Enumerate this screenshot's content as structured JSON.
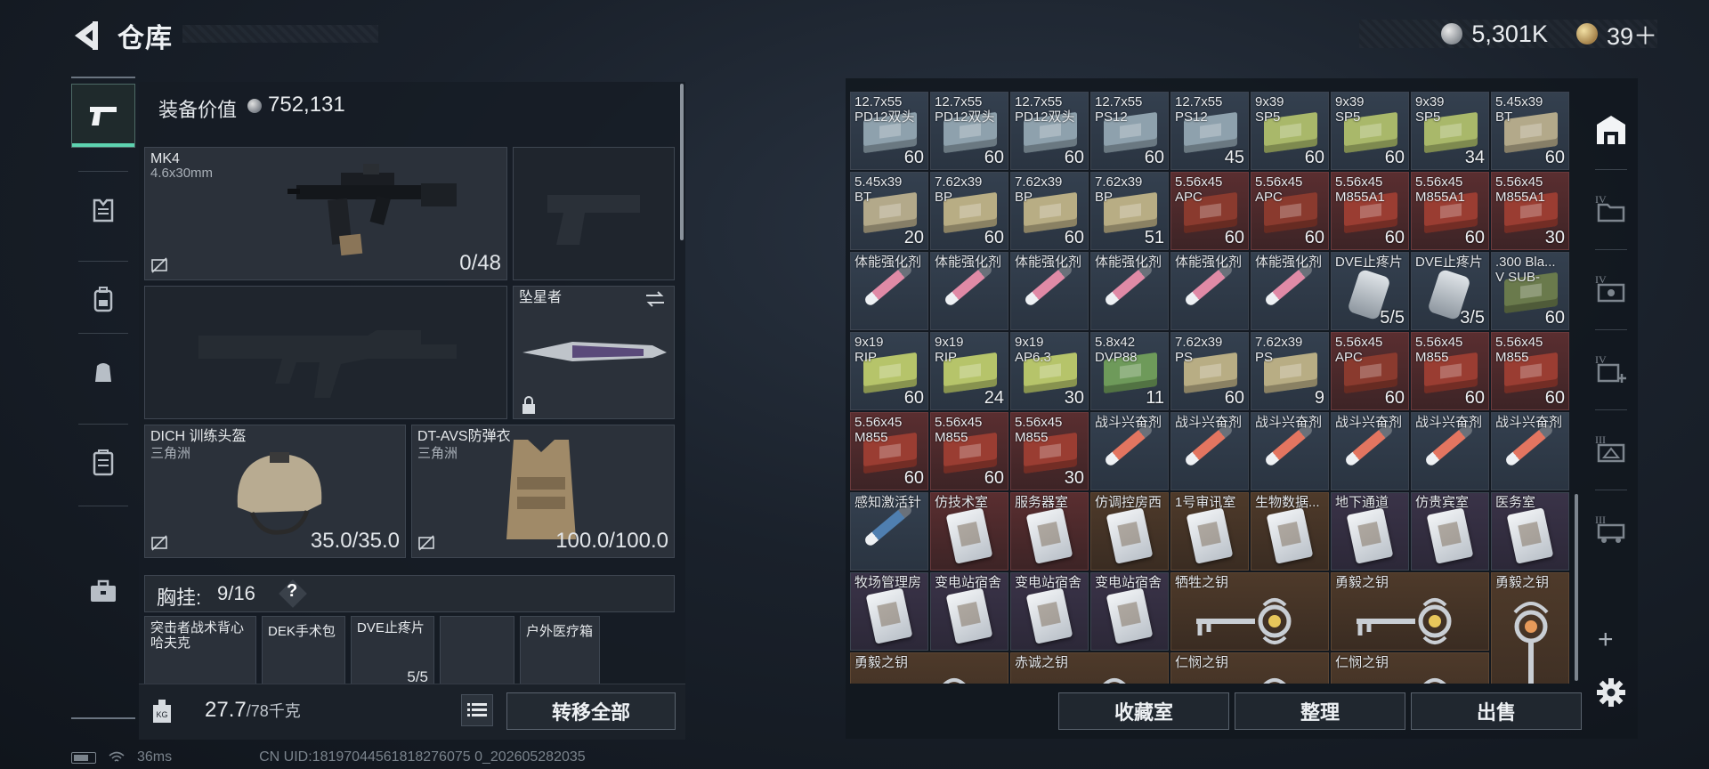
{
  "header": {
    "title": "仓库",
    "currency_silver": "5,301K",
    "currency_gold": "39＋"
  },
  "equipment": {
    "value_label": "装备价值",
    "value": "752,131",
    "primary": {
      "name": "MK4",
      "caliber": "4.6x30mm",
      "ammo": "0/48"
    },
    "melee": {
      "name": "坠星者"
    },
    "helmet": {
      "name": "DICH 训练头盔",
      "origin": "三角洲",
      "durability": "35.0/35.0"
    },
    "armor": {
      "name": "DT-AVS防弹衣",
      "origin": "三角洲",
      "durability": "100.0/100.0"
    },
    "chest_rig": {
      "label": "胸挂:",
      "value": "9/16",
      "help": "?"
    },
    "rig_items": [
      {
        "name": "突击者战术背心\n哈夫克"
      },
      {
        "name": "DEK手术包"
      },
      {
        "name": "DVE止疼片",
        "count": "5/5"
      },
      {
        "name": ""
      },
      {
        "name": "户外医疗箱"
      }
    ]
  },
  "footer_left": {
    "weight": "27.7",
    "weight_max": "/78千克",
    "transfer_all": "转移全部"
  },
  "inventory": [
    [
      {
        "name": "12.7x55\nPD12双头",
        "count": "60",
        "kind": "ammo",
        "color": "#8ea1ad"
      },
      {
        "name": "12.7x55\nPD12双头",
        "count": "60",
        "kind": "ammo",
        "color": "#8ea1ad"
      },
      {
        "name": "12.7x55\nPD12双头",
        "count": "60",
        "kind": "ammo",
        "color": "#8ea1ad"
      },
      {
        "name": "12.7x55\nPS12",
        "count": "60",
        "kind": "ammo",
        "color": "#8ea1ad"
      },
      {
        "name": "12.7x55\nPS12",
        "count": "45",
        "kind": "ammo",
        "color": "#8ea1ad"
      },
      {
        "name": "9x39\nSP5",
        "count": "60",
        "kind": "ammo",
        "color": "#a9b86a"
      },
      {
        "name": "9x39\nSP5",
        "count": "60",
        "kind": "ammo",
        "color": "#a9b86a"
      },
      {
        "name": "9x39\nSP5",
        "count": "34",
        "kind": "ammo",
        "color": "#a9b86a"
      },
      {
        "name": "5.45x39\nBT",
        "count": "60",
        "kind": "ammo",
        "color": "#b3a98a"
      }
    ],
    [
      {
        "name": "5.45x39\nBT",
        "count": "20",
        "kind": "ammo",
        "color": "#b3a98a"
      },
      {
        "name": "7.62x39\nBP",
        "count": "60",
        "kind": "ammo",
        "color": "#b8ad84"
      },
      {
        "name": "7.62x39\nBP",
        "count": "60",
        "kind": "ammo",
        "color": "#b8ad84"
      },
      {
        "name": "7.62x39\nBP",
        "count": "51",
        "kind": "ammo",
        "color": "#b8ad84"
      },
      {
        "name": "5.56x45\nAPC",
        "count": "60",
        "kind": "ammo",
        "color": "#8a3a2e",
        "tone": "red"
      },
      {
        "name": "5.56x45\nAPC",
        "count": "60",
        "kind": "ammo",
        "color": "#8a3a2e",
        "tone": "red"
      },
      {
        "name": "5.56x45\nM855A1",
        "count": "60",
        "kind": "ammo",
        "color": "#9a3d32",
        "tone": "red"
      },
      {
        "name": "5.56x45\nM855A1",
        "count": "60",
        "kind": "ammo",
        "color": "#9a3d32",
        "tone": "red"
      },
      {
        "name": "5.56x45\nM855A1",
        "count": "30",
        "kind": "ammo",
        "color": "#9a3d32",
        "tone": "red"
      }
    ],
    [
      {
        "name": "体能强化剂",
        "count": "",
        "kind": "syringe",
        "color": "#e08aa6"
      },
      {
        "name": "体能强化剂",
        "count": "",
        "kind": "syringe",
        "color": "#e08aa6"
      },
      {
        "name": "体能强化剂",
        "count": "",
        "kind": "syringe",
        "color": "#e08aa6"
      },
      {
        "name": "体能强化剂",
        "count": "",
        "kind": "syringe",
        "color": "#e08aa6"
      },
      {
        "name": "体能强化剂",
        "count": "",
        "kind": "syringe",
        "color": "#e08aa6"
      },
      {
        "name": "体能强化剂",
        "count": "",
        "kind": "syringe",
        "color": "#e08aa6"
      },
      {
        "name": "DVE止疼片",
        "count": "5/5",
        "kind": "painkiller",
        "color": "#cfd5da"
      },
      {
        "name": "DVE止疼片",
        "count": "3/5",
        "kind": "painkiller",
        "color": "#cfd5da"
      },
      {
        "name": ".300 Bla...\nV SUB-",
        "count": "60",
        "kind": "ammo",
        "color": "#6a7a4c"
      }
    ],
    [
      {
        "name": "9x19\nRIP",
        "count": "60",
        "kind": "ammo",
        "color": "#b6c46a"
      },
      {
        "name": "9x19\nRIP",
        "count": "24",
        "kind": "ammo",
        "color": "#b6c46a"
      },
      {
        "name": "9x19\nAP6.3",
        "count": "30",
        "kind": "ammo",
        "color": "#b6c46a"
      },
      {
        "name": "5.8x42\nDVP88",
        "count": "11",
        "kind": "ammo",
        "color": "#6e9a5a"
      },
      {
        "name": "7.62x39\nPS",
        "count": "60",
        "kind": "ammo",
        "color": "#b8ad84"
      },
      {
        "name": "7.62x39\nPS",
        "count": "9",
        "kind": "ammo",
        "color": "#b8ad84"
      },
      {
        "name": "5.56x45\nAPC",
        "count": "60",
        "kind": "ammo",
        "color": "#8a3a2e",
        "tone": "red"
      },
      {
        "name": "5.56x45\nM855",
        "count": "60",
        "kind": "ammo",
        "color": "#9a3d32",
        "tone": "red"
      },
      {
        "name": "5.56x45\nM855",
        "count": "60",
        "kind": "ammo",
        "color": "#9a3d32",
        "tone": "red"
      }
    ],
    [
      {
        "name": "5.56x45\nM855",
        "count": "60",
        "kind": "ammo",
        "color": "#9a3d32",
        "tone": "red"
      },
      {
        "name": "5.56x45\nM855",
        "count": "60",
        "kind": "ammo",
        "color": "#9a3d32",
        "tone": "red"
      },
      {
        "name": "5.56x45\nM855",
        "count": "30",
        "kind": "ammo",
        "color": "#9a3d32",
        "tone": "red"
      },
      {
        "name": "战斗兴奋剂",
        "count": "",
        "kind": "syringe",
        "color": "#e37560"
      },
      {
        "name": "战斗兴奋剂",
        "count": "",
        "kind": "syringe",
        "color": "#e37560"
      },
      {
        "name": "战斗兴奋剂",
        "count": "",
        "kind": "syringe",
        "color": "#e37560"
      },
      {
        "name": "战斗兴奋剂",
        "count": "",
        "kind": "syringe",
        "color": "#e37560"
      },
      {
        "name": "战斗兴奋剂",
        "count": "",
        "kind": "syringe",
        "color": "#e37560"
      },
      {
        "name": "战斗兴奋剂",
        "count": "",
        "kind": "syringe",
        "color": "#e37560"
      }
    ],
    [
      {
        "name": "感知激活针",
        "count": "",
        "kind": "syringe",
        "color": "#4f7fb0"
      },
      {
        "name": "仿技术室",
        "count": "",
        "kind": "keycard",
        "tone": "red"
      },
      {
        "name": "服务器室",
        "count": "",
        "kind": "keycard",
        "tone": "red"
      },
      {
        "name": "仿调控房西",
        "count": "",
        "kind": "keycard",
        "tone": "orange"
      },
      {
        "name": "1号审讯室",
        "count": "",
        "kind": "keycard",
        "tone": "orange"
      },
      {
        "name": "生物数据...",
        "count": "",
        "kind": "keycard",
        "tone": "orange"
      },
      {
        "name": "地下通道",
        "count": "",
        "kind": "keycard",
        "tone": "purple"
      },
      {
        "name": "仿贵宾室",
        "count": "",
        "kind": "keycard",
        "tone": "purple"
      },
      {
        "name": "医务室",
        "count": "",
        "kind": "keycard",
        "tone": "purple"
      }
    ],
    [
      {
        "name": "牧场管理房",
        "count": "",
        "kind": "keycard",
        "tone": "purple"
      },
      {
        "name": "变电站宿舍",
        "count": "",
        "kind": "keycard",
        "tone": "purple"
      },
      {
        "name": "变电站宿舍",
        "count": "",
        "kind": "keycard",
        "tone": "purple"
      },
      {
        "name": "变电站宿舍",
        "count": "",
        "kind": "keycard",
        "tone": "purple"
      },
      {
        "name": "牺牲之钥",
        "count": "",
        "kind": "bigkey",
        "tone": "orange",
        "span": 2
      },
      null,
      {
        "name": "勇毅之钥",
        "count": "",
        "kind": "bigkey",
        "tone": "orange",
        "span": 2
      },
      null,
      {
        "name": "勇毅之钥",
        "count": "",
        "kind": "vkey",
        "tone": "orange",
        "vspan": 2
      }
    ],
    [
      {
        "name": "勇毅之钥",
        "count": "",
        "kind": "bigkey",
        "tone": "orange",
        "span": 2
      },
      null,
      {
        "name": "赤诚之钥",
        "count": "",
        "kind": "bigkey",
        "tone": "orange",
        "span": 2
      },
      null,
      {
        "name": "仁悯之钥",
        "count": "",
        "kind": "bigkey",
        "tone": "orange",
        "span": 2
      },
      null,
      {
        "name": "仁悯之钥",
        "count": "",
        "kind": "bigkey",
        "tone": "orange",
        "span": 2
      },
      null,
      null
    ]
  ],
  "footer_right": {
    "collection": "收藏室",
    "organize": "整理",
    "sell": "出售"
  },
  "status_bar": {
    "ping": "36ms",
    "uid": "CN UID:18197044561818276075 0_202605282035"
  }
}
